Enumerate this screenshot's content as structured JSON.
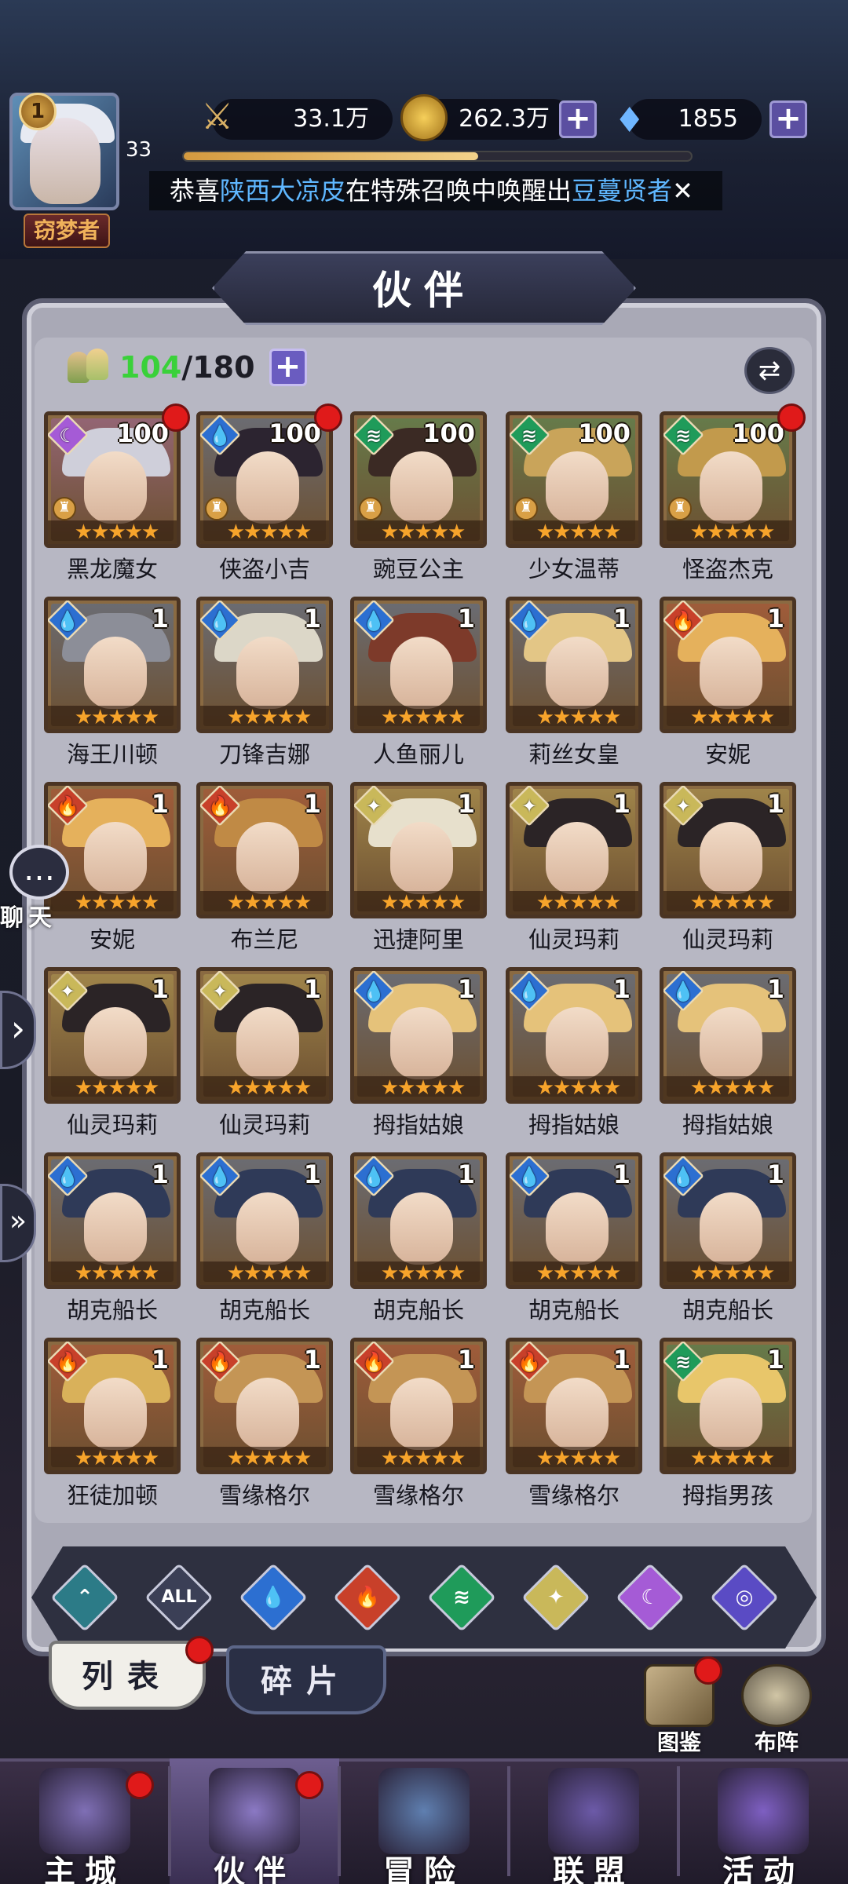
{
  "player": {
    "vip_level": "1",
    "level": "33",
    "title": "窃梦者",
    "power": "33.1万",
    "gold": "262.3万",
    "diamonds": "1855",
    "exp_fraction": 0.58
  },
  "marquee": {
    "prefix": "恭喜",
    "player_name": "陕西大凉皮",
    "middle": "在特殊召唤中唤醒出",
    "hero_name": "豆蔓贤者",
    "close": "✕"
  },
  "header": {
    "title": "伙伴"
  },
  "roster": {
    "current": "104",
    "max": "/180"
  },
  "heroes": [
    {
      "name": "黑龙魔女",
      "level": "100",
      "element": "moon",
      "stars": "★★★★★",
      "dot": true,
      "tower": true
    },
    {
      "name": "侠盗小吉",
      "level": "100",
      "element": "water",
      "stars": "★★★★★",
      "dot": true,
      "tower": true
    },
    {
      "name": "豌豆公主",
      "level": "100",
      "element": "wind",
      "stars": "★★★★★",
      "dot": false,
      "tower": true
    },
    {
      "name": "少女温蒂",
      "level": "100",
      "element": "wind",
      "stars": "★★★★★",
      "dot": false,
      "tower": true
    },
    {
      "name": "怪盗杰克",
      "level": "100",
      "element": "wind",
      "stars": "★★★★★",
      "dot": true,
      "tower": true
    },
    {
      "name": "海王川顿",
      "level": "1",
      "element": "water",
      "stars": "★★★★★",
      "dot": false,
      "tower": false
    },
    {
      "name": "刀锋吉娜",
      "level": "1",
      "element": "water",
      "stars": "★★★★★",
      "dot": false,
      "tower": false
    },
    {
      "name": "人鱼丽儿",
      "level": "1",
      "element": "water",
      "stars": "★★★★★",
      "dot": false,
      "tower": false
    },
    {
      "name": "莉丝女皇",
      "level": "1",
      "element": "water",
      "stars": "★★★★★",
      "dot": false,
      "tower": false
    },
    {
      "name": "安妮",
      "level": "1",
      "element": "fire",
      "stars": "★★★★★",
      "dot": false,
      "tower": false
    },
    {
      "name": "安妮",
      "level": "1",
      "element": "fire",
      "stars": "★★★★★",
      "dot": false,
      "tower": false
    },
    {
      "name": "布兰尼",
      "level": "1",
      "element": "fire",
      "stars": "★★★★★",
      "dot": false,
      "tower": false
    },
    {
      "name": "迅捷阿里",
      "level": "1",
      "element": "light",
      "stars": "★★★★★",
      "dot": false,
      "tower": false
    },
    {
      "name": "仙灵玛莉",
      "level": "1",
      "element": "light",
      "stars": "★★★★★",
      "dot": false,
      "tower": false
    },
    {
      "name": "仙灵玛莉",
      "level": "1",
      "element": "light",
      "stars": "★★★★★",
      "dot": false,
      "tower": false
    },
    {
      "name": "仙灵玛莉",
      "level": "1",
      "element": "light",
      "stars": "★★★★★",
      "dot": false,
      "tower": false
    },
    {
      "name": "仙灵玛莉",
      "level": "1",
      "element": "light",
      "stars": "★★★★★",
      "dot": false,
      "tower": false
    },
    {
      "name": "拇指姑娘",
      "level": "1",
      "element": "water",
      "stars": "★★★★★",
      "dot": false,
      "tower": false
    },
    {
      "name": "拇指姑娘",
      "level": "1",
      "element": "water",
      "stars": "★★★★★",
      "dot": false,
      "tower": false
    },
    {
      "name": "拇指姑娘",
      "level": "1",
      "element": "water",
      "stars": "★★★★★",
      "dot": false,
      "tower": false
    },
    {
      "name": "胡克船长",
      "level": "1",
      "element": "water",
      "stars": "★★★★★",
      "dot": false,
      "tower": false
    },
    {
      "name": "胡克船长",
      "level": "1",
      "element": "water",
      "stars": "★★★★★",
      "dot": false,
      "tower": false
    },
    {
      "name": "胡克船长",
      "level": "1",
      "element": "water",
      "stars": "★★★★★",
      "dot": false,
      "tower": false
    },
    {
      "name": "胡克船长",
      "level": "1",
      "element": "water",
      "stars": "★★★★★",
      "dot": false,
      "tower": false
    },
    {
      "name": "胡克船长",
      "level": "1",
      "element": "water",
      "stars": "★★★★★",
      "dot": false,
      "tower": false
    },
    {
      "name": "狂徒加顿",
      "level": "1",
      "element": "fire",
      "stars": "★★★★★",
      "dot": false,
      "tower": false
    },
    {
      "name": "雪缘格尔",
      "level": "1",
      "element": "fire",
      "stars": "★★★★★",
      "dot": false,
      "tower": false
    },
    {
      "name": "雪缘格尔",
      "level": "1",
      "element": "fire",
      "stars": "★★★★★",
      "dot": false,
      "tower": false
    },
    {
      "name": "雪缘格尔",
      "level": "1",
      "element": "fire",
      "stars": "★★★★★",
      "dot": false,
      "tower": false
    },
    {
      "name": "拇指男孩",
      "level": "1",
      "element": "wind",
      "stars": "★★★★★",
      "dot": false,
      "tower": false
    }
  ],
  "element_colors": {
    "moon": "#a55bd6",
    "water": "#2c6fd1",
    "wind": "#1f9b5a",
    "fire": "#c8402a",
    "light": "#c9b85a",
    "earth": "#2c7b87",
    "all": "#3b3f56",
    "space": "#5a4bc4"
  },
  "element_glyphs": {
    "moon": "☾",
    "water": "💧",
    "wind": "≋",
    "fire": "🔥",
    "light": "✦",
    "earth": "⌃",
    "all": "ALL",
    "space": "◎"
  },
  "filters": [
    {
      "id": "earth",
      "label": "⌃"
    },
    {
      "id": "all",
      "label": "ALL"
    },
    {
      "id": "water",
      "label": "💧"
    },
    {
      "id": "fire",
      "label": "🔥"
    },
    {
      "id": "wind",
      "label": "≋"
    },
    {
      "id": "light",
      "label": "✦"
    },
    {
      "id": "moon",
      "label": "☾"
    },
    {
      "id": "space",
      "label": "◎"
    }
  ],
  "tabs": {
    "list": "列表",
    "fragments": "碎片"
  },
  "side": {
    "codex": "图鉴",
    "formation": "布阵",
    "chat": "聊天"
  },
  "nav": [
    {
      "label": "主城",
      "dot": true
    },
    {
      "label": "伙伴",
      "dot": true
    },
    {
      "label": "冒险",
      "dot": false
    },
    {
      "label": "联盟",
      "dot": false
    },
    {
      "label": "活动",
      "dot": false
    }
  ]
}
